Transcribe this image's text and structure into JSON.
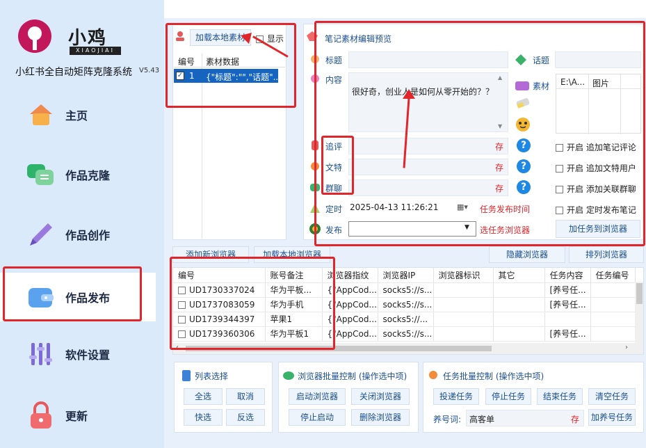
{
  "app": {
    "brand": "小鸡",
    "brand_sub": "XIAOJIAI",
    "title": "小红书全自动矩阵克隆系统",
    "version": "V5.43"
  },
  "nav": [
    {
      "label": "主页",
      "icon": "home-icon"
    },
    {
      "label": "作品克隆",
      "icon": "chat-icon"
    },
    {
      "label": "作品创作",
      "icon": "pen-icon"
    },
    {
      "label": "作品发布",
      "icon": "wallet-icon"
    },
    {
      "label": "软件设置",
      "icon": "sliders-icon"
    },
    {
      "label": "更新",
      "icon": "lock-icon"
    }
  ],
  "material": {
    "load_button": "加载本地素材",
    "show_label": "显示",
    "headers": [
      "编号",
      "素材数据"
    ],
    "rows": [
      {
        "id": "1",
        "data": "{\"标题\":\"\",\"话题\"..."
      }
    ]
  },
  "preview": {
    "title": "笔记素材编辑预览",
    "title_label": "标题",
    "topic_label": "话题",
    "content_label": "内容",
    "content_text": "很好奇，创业人是如何从零开始的？？",
    "material_label": "素材",
    "material_headers": [
      "E:\\A...",
      "图片"
    ],
    "follow_label": "追评",
    "text_label": "文特",
    "group_label": "群聊",
    "required": "存",
    "time_label": "定时",
    "time_value": "2025-04-13 11:26:21",
    "time_hint": "任务发布时间",
    "publish_label": "发布",
    "publish_hint": "选任务浏览器",
    "options": [
      "开启 追加笔记评论",
      "开启 追加文特用户",
      "开启 添加关联群聊",
      "开启 定时发布笔记"
    ],
    "add_task_button": "加任务到浏览器"
  },
  "browser_toolbar": {
    "add_new": "添加新浏览器",
    "load_local": "加载本地浏览器",
    "hide": "隐藏浏览器",
    "arrange": "排列浏览器"
  },
  "browser_table": {
    "headers": [
      "编号",
      "账号备注",
      "浏览器指纹",
      "浏览器IP",
      "浏览器标识",
      "其它",
      "任务内容",
      "任务编号"
    ],
    "rows": [
      [
        "UD1730337024",
        "华为平板...",
        "{\"AppCod...",
        "socks5://s...",
        "",
        "",
        "[养号任...",
        ""
      ],
      [
        "UD1737083059",
        "华为手机",
        "{\"AppCod...",
        "socks5://s...",
        "",
        "",
        "[养号任...",
        ""
      ],
      [
        "UD1739344397",
        "苹果1",
        "{\"AppCod...",
        "socks5://...",
        "",
        "",
        "",
        ""
      ],
      [
        "UD1739360306",
        "华为平板1",
        "{\"AppCod...",
        "socks5://s...",
        "",
        "",
        "[养号任...",
        ""
      ]
    ]
  },
  "list_select": {
    "title": "列表选择",
    "buttons": [
      "全选",
      "取消",
      "快选",
      "反选"
    ]
  },
  "browser_batch": {
    "title": "浏览器批量控制 (操作选中项)",
    "buttons": [
      "启动浏览器",
      "关闭浏览器",
      "停止启动",
      "删除浏览器"
    ]
  },
  "task_batch": {
    "title": "任务批量控制 (操作选中项)",
    "buttons": [
      "投递任务",
      "停止任务",
      "结束任务",
      "清空任务"
    ],
    "keyword_label": "养号词:",
    "keyword_value": "高客单",
    "required": "存",
    "add_task": "加养号任务"
  },
  "colors": {
    "accent": "#1b4f8f",
    "annotation": "#e0252b",
    "sidebar_bg": "#dbeafb"
  }
}
